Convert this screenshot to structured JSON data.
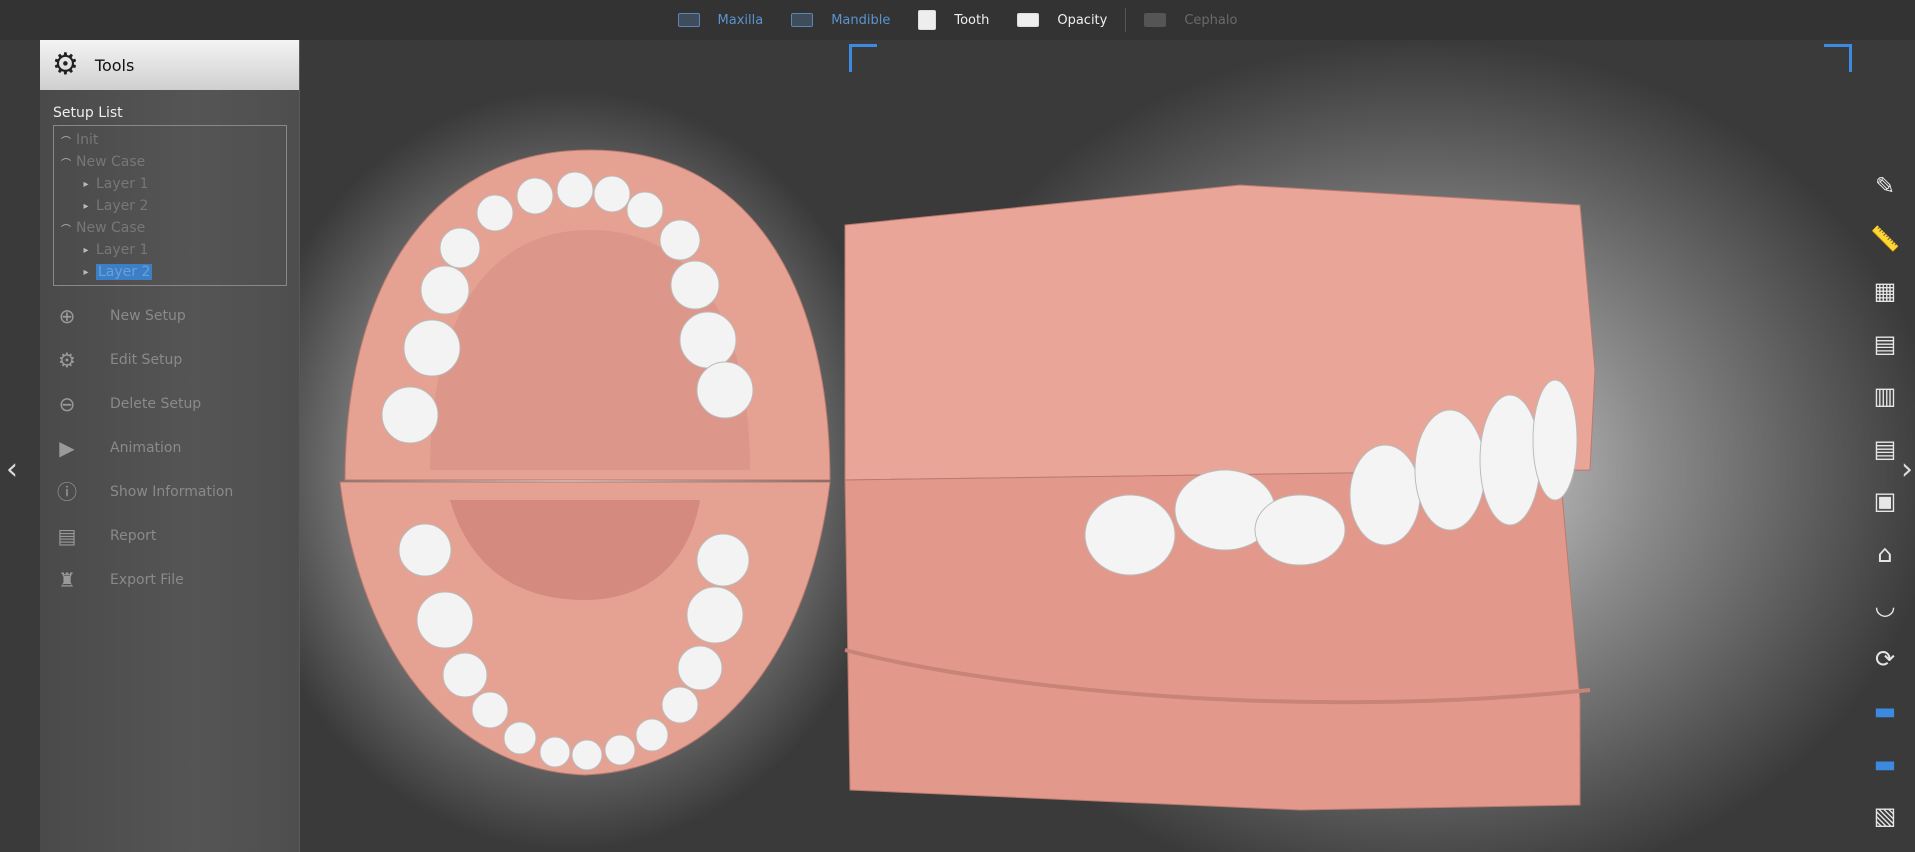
{
  "topbar": {
    "items": [
      {
        "label": "Maxilla",
        "icon": "maxilla-icon",
        "color": "#5b93cf"
      },
      {
        "label": "Mandible",
        "icon": "mandible-icon",
        "color": "#5b93cf"
      },
      {
        "label": "Tooth",
        "icon": "tooth-icon",
        "color": "#f0f0f0"
      },
      {
        "label": "Opacity",
        "icon": "opacity-icon",
        "color": "#f0f0f0"
      },
      {
        "label": "Cephalo",
        "icon": "cephalo-icon",
        "color": "#6a6a6a"
      }
    ]
  },
  "panel": {
    "title": "Tools",
    "setup_list_label": "Setup List",
    "tree": [
      {
        "label": "Init",
        "level": 0
      },
      {
        "label": "New Case",
        "level": 0
      },
      {
        "label": "Layer 1",
        "level": 1
      },
      {
        "label": "Layer 2",
        "level": 1
      },
      {
        "label": "New Case",
        "level": 0
      },
      {
        "label": "Layer 1",
        "level": 1
      },
      {
        "label": "Layer 2",
        "level": 1,
        "selected": true
      }
    ],
    "menu": [
      "New Setup",
      "Edit Setup",
      "Delete Setup",
      "Animation",
      "Show Information",
      "Report",
      "Export File"
    ]
  },
  "colors": {
    "accent": "#3d8ae0",
    "gum": "#e8a598",
    "tooth": "#f2f2f2"
  }
}
